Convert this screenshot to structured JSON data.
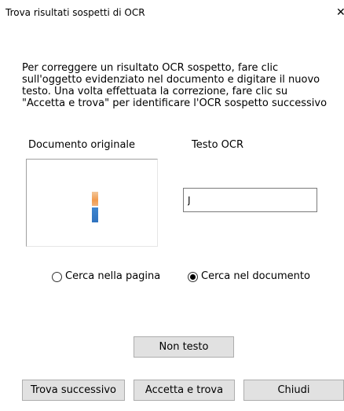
{
  "window": {
    "title": "Trova risultati sospetti di OCR",
    "close_glyph": "✕"
  },
  "instructions": "Per correggere un risultato OCR sospetto, fare clic\nsull'oggetto evidenziato nel documento e digitare il nuovo\ntesto. Una volta effettuata la correzione, fare clic su\n\"Accetta e trova\" per identificare l'OCR sospetto successivo",
  "labels": {
    "original_document": "Documento originale",
    "ocr_text": "Testo OCR"
  },
  "preview": {
    "icon": "suspect-character-image",
    "colors": {
      "top": "#f29b4e",
      "bottom": "#2f73bf"
    }
  },
  "ocr_field": {
    "value": "J"
  },
  "search_scope": {
    "options": [
      {
        "label": "Cerca nella pagina",
        "selected": false
      },
      {
        "label": "Cerca nel documento",
        "selected": true
      }
    ]
  },
  "buttons": {
    "non_text": "Non testo",
    "find_next": "Trova successivo",
    "accept_and_find": "Accetta e trova",
    "close": "Chiudi"
  }
}
